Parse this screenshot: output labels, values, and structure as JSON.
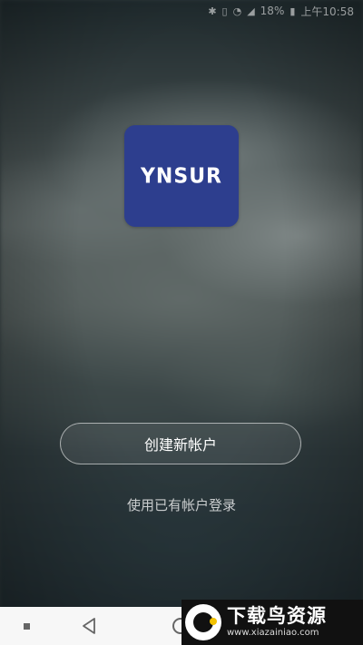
{
  "status_bar": {
    "battery": "18%",
    "time": "上午10:58",
    "icons": [
      "bluetooth-icon",
      "vibrate-icon",
      "wifi-off-icon",
      "signal-icon",
      "battery-icon"
    ]
  },
  "logo": {
    "text": "YNSUR",
    "color": "#2d3e8e"
  },
  "create_account_button": {
    "label": "创建新帐户"
  },
  "login_link": {
    "label": "使用已有帐户登录"
  },
  "nav_bar": {
    "items": [
      "recent-apps-icon",
      "back-icon",
      "home-icon"
    ]
  },
  "watermark": {
    "title": "下载鸟资源",
    "url": "www.xiazainiao.com"
  }
}
